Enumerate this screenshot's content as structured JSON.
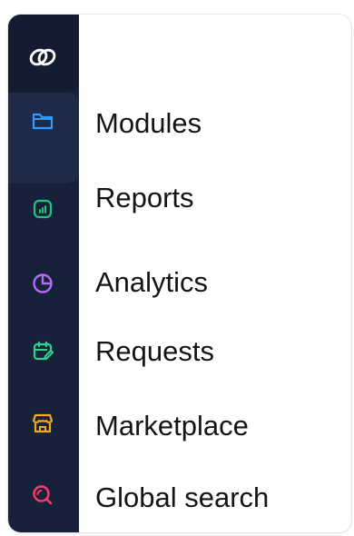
{
  "logo_icon": "chain-link-logo-icon",
  "colors": {
    "rail": "#18213a",
    "rail_top": "#141c32",
    "rail_active": "#1e2a48",
    "modules_icon": "#2f9bff",
    "reports_icon": "#22c07a",
    "analytics_icon": "#b36cf5",
    "requests_icon": "#2fd38f",
    "marketplace_icon": "#f5a623",
    "search_icon": "#ff3b6b"
  },
  "menu": {
    "items": [
      {
        "label": "Modules",
        "icon": "folder-icon"
      },
      {
        "label": "Reports",
        "icon": "bar-chart-icon"
      },
      {
        "label": "Analytics",
        "icon": "pie-chart-icon"
      },
      {
        "label": "Requests",
        "icon": "calendar-edit-icon"
      },
      {
        "label": "Marketplace",
        "icon": "storefront-icon"
      },
      {
        "label": "Global search",
        "icon": "search-icon"
      }
    ]
  }
}
